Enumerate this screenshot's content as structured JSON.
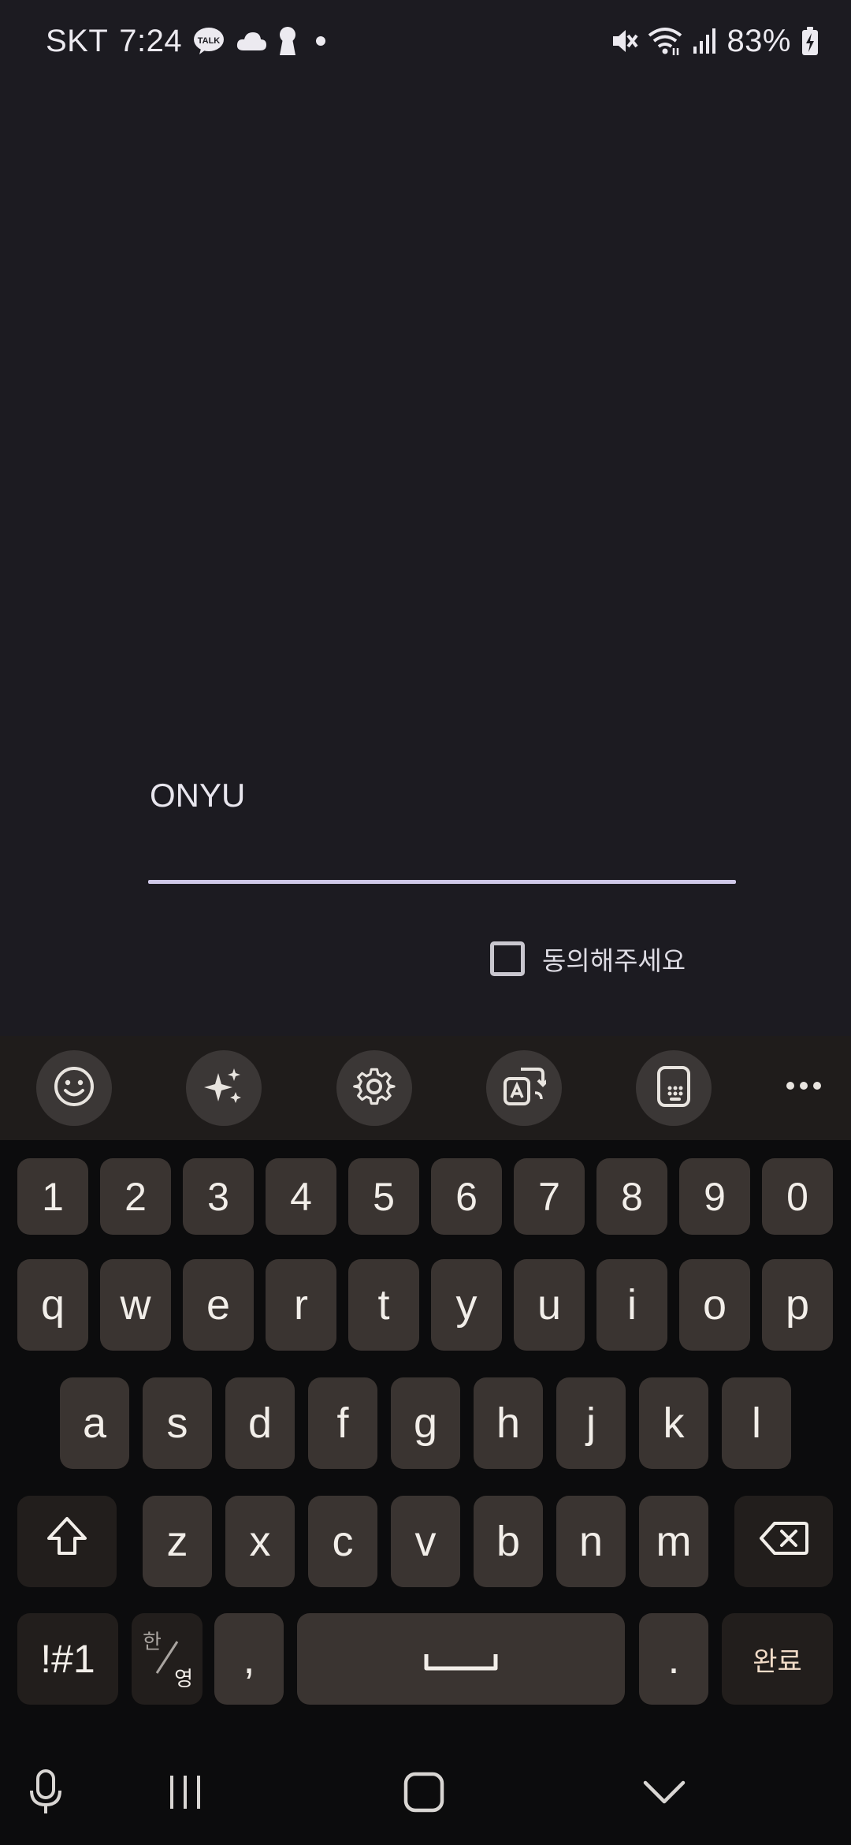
{
  "status_bar": {
    "carrier": "SKT",
    "time": "7:24",
    "notification_icons": [
      "kakaotalk-icon",
      "cloud-icon",
      "keyhole-icon",
      "dot-icon"
    ],
    "system_icons": [
      "mute-icon",
      "wifi-icon",
      "signal-icon"
    ],
    "battery": "83%"
  },
  "form": {
    "name_value": "ONYU",
    "agree_label": "동의해주세요",
    "agree_checked": false
  },
  "keyboard": {
    "toolbar": [
      "emoji-icon",
      "sparkle-icon",
      "settings-icon",
      "translate-icon",
      "one-hand-keyboard-icon",
      "more-icon"
    ],
    "row_numbers": [
      "1",
      "2",
      "3",
      "4",
      "5",
      "6",
      "7",
      "8",
      "9",
      "0"
    ],
    "row_top": [
      "q",
      "w",
      "e",
      "r",
      "t",
      "y",
      "u",
      "i",
      "o",
      "p"
    ],
    "row_middle": [
      "a",
      "s",
      "d",
      "f",
      "g",
      "h",
      "j",
      "k",
      "l"
    ],
    "row_bottom": [
      "z",
      "x",
      "c",
      "v",
      "b",
      "n",
      "m"
    ],
    "symbols_label": "!#1",
    "lang_top": "한",
    "lang_bottom": "영",
    "comma_label": ",",
    "period_label": ".",
    "done_label": "완료"
  },
  "nav_bar": [
    "mic-icon",
    "recents-icon",
    "home-icon",
    "back-icon"
  ],
  "colors": {
    "background": "#1c1b21",
    "underline_accent": "#cfc8e8",
    "key": "#3a3431",
    "keyboard_bg": "#0c0c0d"
  }
}
